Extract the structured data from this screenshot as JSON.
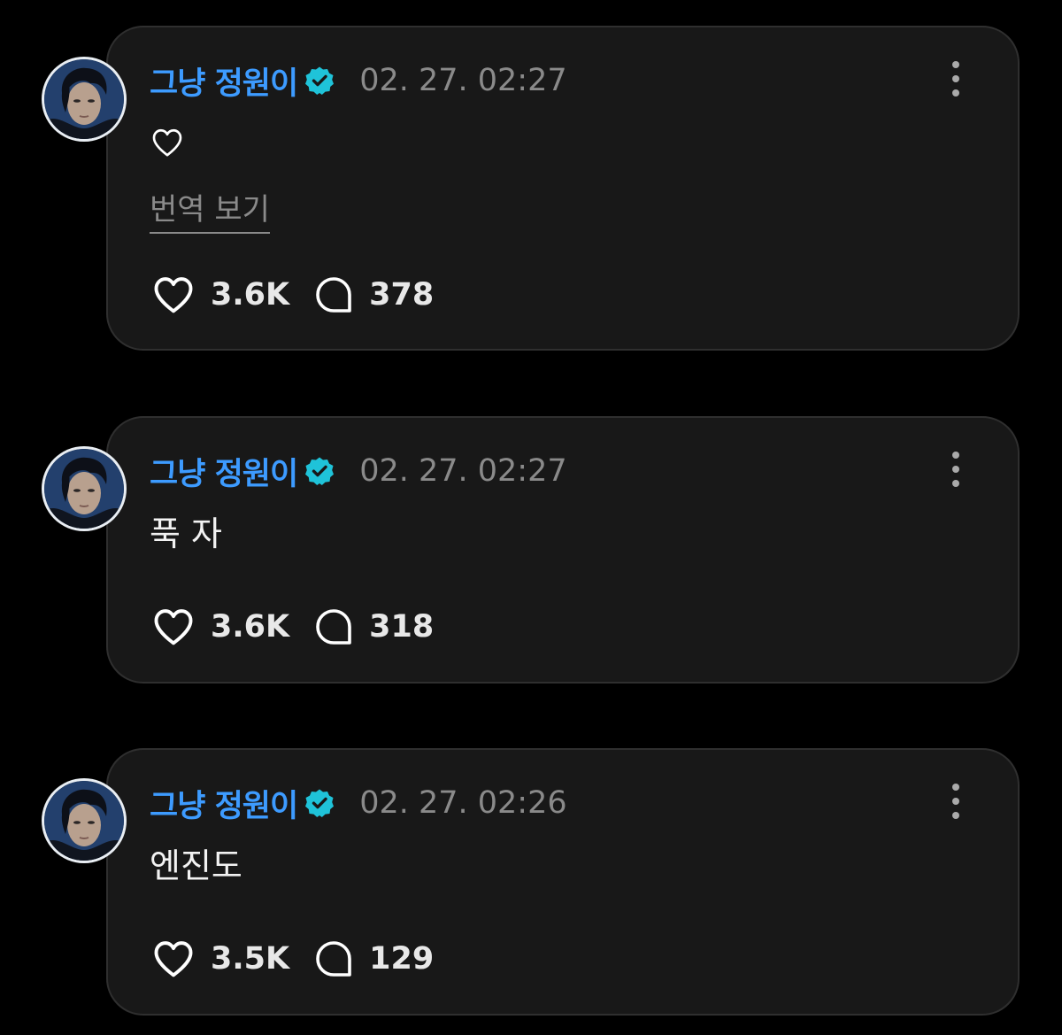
{
  "colors": {
    "background": "#000000",
    "card": "#181818",
    "username": "#3d9bff",
    "verified_badge": "#1fc3d9",
    "timestamp": "#8a8a8a"
  },
  "posts": [
    {
      "username": "그냥 정원이",
      "timestamp": "02. 27. 02:27",
      "text_icon": "heart-outline-icon",
      "text": "",
      "translate_label": "번역 보기",
      "likes": "3.6K",
      "replies": "378"
    },
    {
      "username": "그냥 정원이",
      "timestamp": "02. 27. 02:27",
      "text": "푹 자",
      "likes": "3.6K",
      "replies": "318"
    },
    {
      "username": "그냥 정원이",
      "timestamp": "02. 27. 02:26",
      "text": "엔진도",
      "likes": "3.5K",
      "replies": "129"
    }
  ]
}
